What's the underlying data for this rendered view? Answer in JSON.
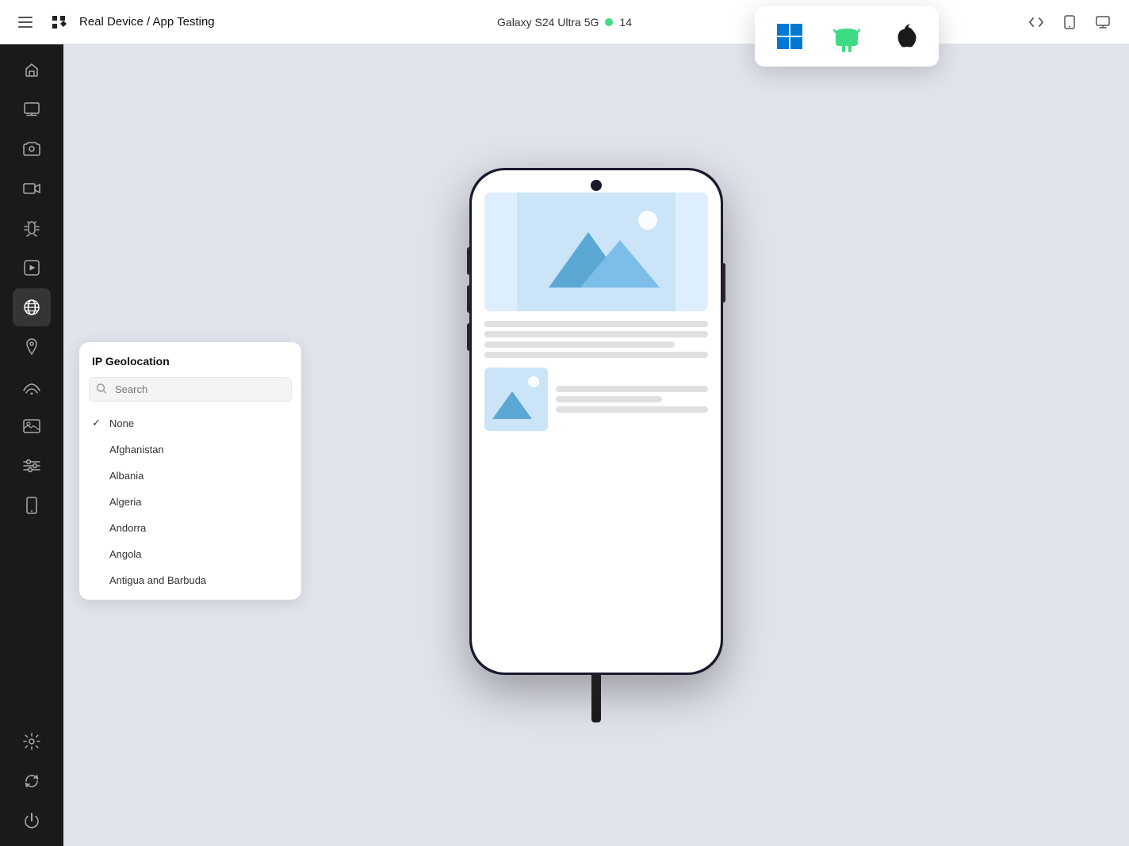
{
  "topbar": {
    "title": "Real Device / App Testing",
    "hamburger_label": "☰",
    "device_name": "Galaxy S24 Ultra 5G",
    "android_version": "14",
    "code_icon": "</>",
    "phone_icon": "📱",
    "screen_icon": "⬜"
  },
  "platform_picker": {
    "windows_label": "Windows",
    "android_label": "Android",
    "apple_label": "Apple"
  },
  "sidebar": {
    "items": [
      {
        "name": "home",
        "icon": "⌂",
        "label": "Home"
      },
      {
        "name": "screen",
        "icon": "▦",
        "label": "Screen"
      },
      {
        "name": "camera",
        "icon": "📷",
        "label": "Camera"
      },
      {
        "name": "video",
        "icon": "🎥",
        "label": "Video"
      },
      {
        "name": "bug",
        "icon": "🐛",
        "label": "Bug"
      },
      {
        "name": "play",
        "icon": "▶",
        "label": "Play"
      },
      {
        "name": "globe",
        "icon": "🌐",
        "label": "Globe",
        "active": true
      },
      {
        "name": "location",
        "icon": "📍",
        "label": "Location"
      },
      {
        "name": "signal",
        "icon": "📶",
        "label": "Signal"
      },
      {
        "name": "image",
        "icon": "🖼",
        "label": "Image"
      },
      {
        "name": "sliders",
        "icon": "⚙",
        "label": "Sliders"
      },
      {
        "name": "device",
        "icon": "📱",
        "label": "Device"
      },
      {
        "name": "settings",
        "icon": "⚙",
        "label": "Settings"
      },
      {
        "name": "refresh",
        "icon": "↺",
        "label": "Refresh"
      },
      {
        "name": "power",
        "icon": "⏻",
        "label": "Power"
      }
    ]
  },
  "geo_panel": {
    "title": "IP Geolocation",
    "search_placeholder": "Search",
    "countries": [
      {
        "name": "None",
        "selected": true
      },
      {
        "name": "Afghanistan",
        "selected": false
      },
      {
        "name": "Albania",
        "selected": false
      },
      {
        "name": "Algeria",
        "selected": false
      },
      {
        "name": "Andorra",
        "selected": false
      },
      {
        "name": "Angola",
        "selected": false
      },
      {
        "name": "Antigua and Barbuda",
        "selected": false
      }
    ]
  },
  "colors": {
    "sidebar_bg": "#1a1a1a",
    "active_sidebar": "rgba(255,255,255,0.12)",
    "android_green": "#3ddc84",
    "windows_blue": "#0078d4",
    "android_robot": "#3ddc84",
    "apple_dark": "#1a1a1a",
    "accent": "#5b6af7"
  }
}
